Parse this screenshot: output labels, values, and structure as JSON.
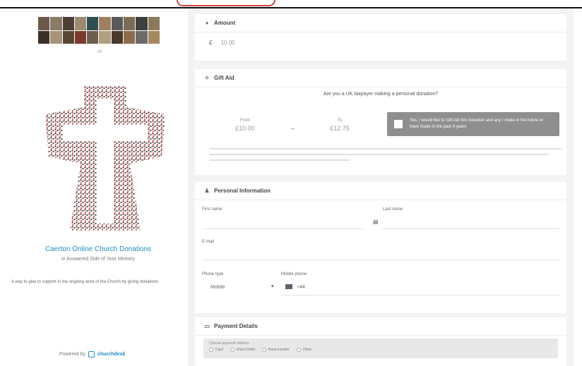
{
  "sidebar": {
    "logo_mark": "m",
    "church_name": "Caerton Online Church Donations",
    "church_sub": "in Answered Side of Your Ministry",
    "church_desc": "A way to give to support in the ongoing work of the Church by giving donations",
    "powered_by": "Powered by",
    "brand": "churchdesk"
  },
  "amount": {
    "title": "Amount",
    "currency": "£",
    "value": "10.00"
  },
  "gift_aid": {
    "title": "Gift Aid",
    "question": "Are you a UK taxpayer making a personal donation?",
    "col1_label": "From",
    "col1_value": "£10.00",
    "arrow": "→",
    "col2_label": "To",
    "col2_value": "£12.75",
    "checkbox_text": "Yes, I would like to Gift Aid this donation and any I make in the future or have made in the past 4 years"
  },
  "personal": {
    "title": "Personal Information",
    "first_name_label": "First name",
    "last_name_label": "Last name",
    "email_label": "E-mail",
    "phone_type_label": "Phone type",
    "phone_type_value": "Mobile",
    "mobile_label": "Mobile phone",
    "mobile_prefix": "+44"
  },
  "payment": {
    "title": "Payment Details",
    "methods_label": "Choose payment method",
    "options": [
      "Card",
      "Direct Debit",
      "Bank transfer",
      "Other"
    ]
  },
  "icons": {
    "amount": "diamond-icon",
    "gift_aid": "gift-icon",
    "personal": "person-icon",
    "payment": "card-icon",
    "contact": "contact-card-icon",
    "chevron": "chevron-down-icon",
    "flag": "uk-flag-icon"
  },
  "colors": {
    "accent": "#1e8bc3",
    "checkbox_panel": "#8f8f8f",
    "background": "#f3f3f3"
  }
}
